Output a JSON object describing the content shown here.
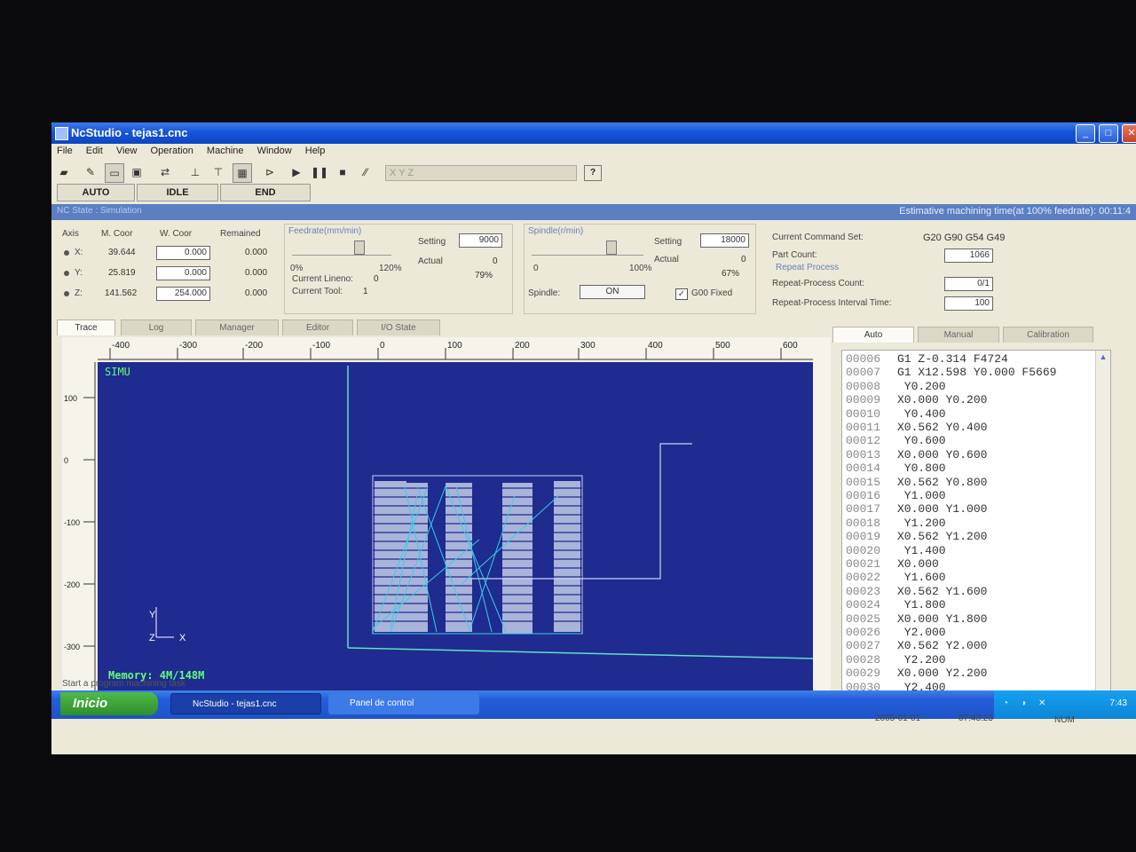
{
  "window": {
    "title": "NcStudio - tejas1.cnc",
    "min": "_",
    "max": "□",
    "close": "✕"
  },
  "menu": [
    "File",
    "Edit",
    "View",
    "Operation",
    "Machine",
    "Window",
    "Help"
  ],
  "toolbar": {
    "axes_placeholder": "X        Y        Z",
    "help": "?"
  },
  "modes": {
    "auto": "AUTO",
    "idle": "IDLE",
    "end": "END"
  },
  "status_band": {
    "left": "NC State : Simulation",
    "right": "Estimative machining time(at 100% feedrate): 00:11:4"
  },
  "coords": {
    "headers": {
      "axis": "Axis",
      "mcoor": "M. Coor",
      "wcoor": "W. Coor",
      "remained": "Remained"
    },
    "rows": [
      {
        "axis": "X:",
        "m": "39.644",
        "w": "0.000",
        "r": "0.000"
      },
      {
        "axis": "Y:",
        "m": "25.819",
        "w": "0.000",
        "r": "0.000"
      },
      {
        "axis": "Z:",
        "m": "141.562",
        "w": "254.000",
        "r": "0.000"
      }
    ]
  },
  "feedrate": {
    "title": "Feedrate(mm/min)",
    "min": "0%",
    "max": "120%",
    "setting_label": "Setting",
    "setting": "9000",
    "actual_label": "Actual",
    "actual": "0",
    "percent": "79%",
    "line_label": "Current Lineno:",
    "line": "0",
    "tool_label": "Current Tool:",
    "tool": "1"
  },
  "spindle": {
    "title": "Spindle(r/min)",
    "min": "0",
    "max": "100%",
    "setting_label": "Setting",
    "setting": "18000",
    "actual_label": "Actual",
    "actual": "0",
    "percent": "67%",
    "spindle_label": "Spindle:",
    "spindle_btn": "ON",
    "g00_label": "G00 Fixed"
  },
  "commands": {
    "set_label": "Current Command Set:",
    "set": "G20 G90 G54 G49",
    "part_label": "Part Count:",
    "part": "1066",
    "repeat_title": "Repeat Process",
    "repeat_count_label": "Repeat-Process Count:",
    "repeat_count": "0/1",
    "interval_label": "Repeat-Process Interval Time:",
    "interval": "100"
  },
  "left_tabs": [
    "Trace",
    "Log",
    "Manager",
    "Editor",
    "I/O State"
  ],
  "right_tabs": [
    "Auto",
    "Manual",
    "Calibration"
  ],
  "view": {
    "simu": "SIMU",
    "memory": "Memory: 4M/148M",
    "axis_y": "Y",
    "axis_z": "Z",
    "axis_x": "X"
  },
  "ruler_top": [
    "-400",
    "-300",
    "-200",
    "-100",
    "0",
    "100",
    "200",
    "300",
    "400",
    "500",
    "600"
  ],
  "ruler_left": [
    "100",
    "0",
    "-100",
    "-200",
    "-300"
  ],
  "code_lines": [
    {
      "n": "00006",
      "c": "G1   Z-0.314 F4724"
    },
    {
      "n": "00007",
      "c": "G1 X12.598 Y0.000  F5669"
    },
    {
      "n": "00008",
      "c": "  Y0.200"
    },
    {
      "n": "00009",
      "c": "X0.000 Y0.200"
    },
    {
      "n": "00010",
      "c": "  Y0.400"
    },
    {
      "n": "00011",
      "c": "X0.562 Y0.400"
    },
    {
      "n": "00012",
      "c": "  Y0.600"
    },
    {
      "n": "00013",
      "c": "X0.000 Y0.600"
    },
    {
      "n": "00014",
      "c": "  Y0.800"
    },
    {
      "n": "00015",
      "c": "X0.562 Y0.800"
    },
    {
      "n": "00016",
      "c": "  Y1.000"
    },
    {
      "n": "00017",
      "c": "X0.000 Y1.000"
    },
    {
      "n": "00018",
      "c": "  Y1.200"
    },
    {
      "n": "00019",
      "c": "X0.562 Y1.200"
    },
    {
      "n": "00020",
      "c": "  Y1.400"
    },
    {
      "n": "00021",
      "c": "X0.000"
    },
    {
      "n": "00022",
      "c": "  Y1.600"
    },
    {
      "n": "00023",
      "c": "X0.562 Y1.600"
    },
    {
      "n": "00024",
      "c": "  Y1.800"
    },
    {
      "n": "00025",
      "c": "X0.000 Y1.800"
    },
    {
      "n": "00026",
      "c": "  Y2.000"
    },
    {
      "n": "00027",
      "c": "X0.562 Y2.000"
    },
    {
      "n": "00028",
      "c": "  Y2.200"
    },
    {
      "n": "00029",
      "c": "X0.000 Y2.200"
    },
    {
      "n": "00030",
      "c": "  Y2.400"
    }
  ],
  "status_hint": "Start a program machining task",
  "taskbar": {
    "start": "Inicio",
    "task1": "NcStudio - tejas1.cnc",
    "task2": "Panel de control",
    "date": "2005-01-01",
    "time": "07:43:23",
    "num": "NUM",
    "clock": "7:43"
  }
}
